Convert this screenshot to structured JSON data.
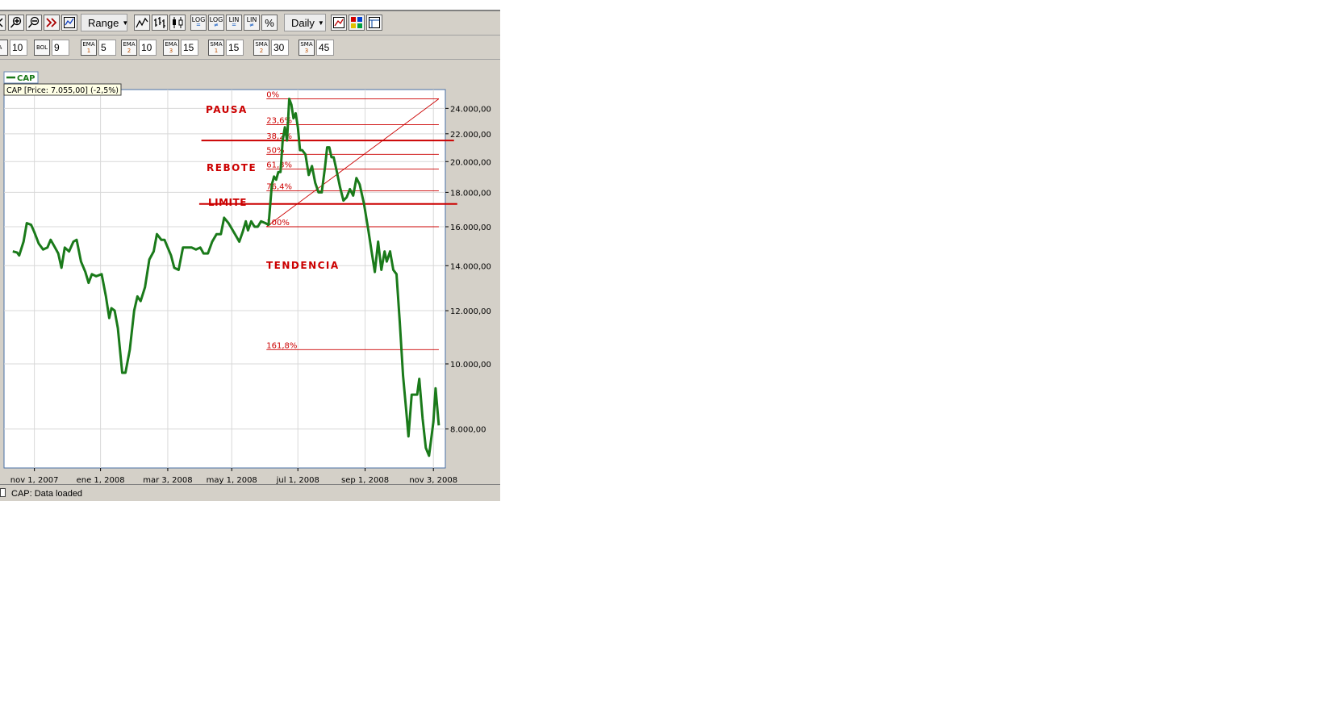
{
  "toolbar": {
    "range_label": "Range",
    "interval_label": "Daily",
    "scale_buttons": [
      {
        "top": "LOG",
        "bottom": "="
      },
      {
        "top": "LOG",
        "bottom": "≠"
      },
      {
        "top": "LIN",
        "bottom": "="
      },
      {
        "top": "LIN",
        "bottom": "≠"
      }
    ],
    "percent_label": "%"
  },
  "indicators": [
    {
      "name": "A",
      "sub": "",
      "value": "10"
    },
    {
      "name": "BOL",
      "sub": "",
      "value": "9"
    },
    {
      "name": "EMA",
      "sub": "1",
      "value": "5"
    },
    {
      "name": "EMA",
      "sub": "2",
      "value": "10"
    },
    {
      "name": "EMA",
      "sub": "3",
      "value": "15"
    },
    {
      "name": "SMA",
      "sub": "1",
      "value": "15"
    },
    {
      "name": "SMA",
      "sub": "2",
      "value": "30"
    },
    {
      "name": "SMA",
      "sub": "3",
      "value": "45"
    }
  ],
  "legend": {
    "symbol": "CAP",
    "info": "CAP [Price: 7.055,00] (-2,5%)"
  },
  "status": {
    "text": "CAP: Data loaded"
  },
  "annotations": {
    "pausa": "PAUSA",
    "rebote": "REBOTE",
    "limite": "LIMITE",
    "tendencia": "TENDENCIA"
  },
  "colors": {
    "series": "#1a7a1a",
    "annotation": "#cc0000"
  },
  "chart_data": {
    "type": "line",
    "title": "",
    "scale": "log",
    "grid": true,
    "legend_position": "top-left",
    "x_range": [
      "2007-10-04",
      "2008-11-14"
    ],
    "ylim": [
      7000,
      25600
    ],
    "x_ticks": [
      {
        "date": "2007-11-01",
        "label": "nov 1, 2007"
      },
      {
        "date": "2008-01-01",
        "label": "ene 1, 2008"
      },
      {
        "date": "2008-03-03",
        "label": "mar 3, 2008"
      },
      {
        "date": "2008-05-01",
        "label": "may 1, 2008"
      },
      {
        "date": "2008-07-01",
        "label": "jul 1, 2008"
      },
      {
        "date": "2008-09-01",
        "label": "sep 1, 2008"
      },
      {
        "date": "2008-11-03",
        "label": "nov 3, 2008"
      }
    ],
    "y_ticks": [
      {
        "value": 8000,
        "label": "8.000,00"
      },
      {
        "value": 10000,
        "label": "10.000,00"
      },
      {
        "value": 12000,
        "label": "12.000,00"
      },
      {
        "value": 14000,
        "label": "14.000,00"
      },
      {
        "value": 16000,
        "label": "16.000,00"
      },
      {
        "value": 18000,
        "label": "18.000,00"
      },
      {
        "value": 20000,
        "label": "20.000,00"
      },
      {
        "value": 22000,
        "label": "22.000,00"
      },
      {
        "value": 24000,
        "label": "24.000,00"
      }
    ],
    "series": [
      {
        "name": "CAP",
        "points": [
          [
            "2007-10-12",
            14700
          ],
          [
            "2007-10-16",
            14650
          ],
          [
            "2007-10-18",
            14500
          ],
          [
            "2007-10-22",
            15200
          ],
          [
            "2007-10-25",
            16200
          ],
          [
            "2007-10-29",
            16100
          ],
          [
            "2007-11-01",
            15700
          ],
          [
            "2007-11-05",
            15100
          ],
          [
            "2007-11-09",
            14800
          ],
          [
            "2007-11-13",
            14900
          ],
          [
            "2007-11-16",
            15300
          ],
          [
            "2007-11-20",
            14900
          ],
          [
            "2007-11-23",
            14600
          ],
          [
            "2007-11-26",
            13900
          ],
          [
            "2007-11-29",
            14900
          ],
          [
            "2007-12-03",
            14700
          ],
          [
            "2007-12-07",
            15200
          ],
          [
            "2007-12-10",
            15300
          ],
          [
            "2007-12-14",
            14200
          ],
          [
            "2007-12-18",
            13700
          ],
          [
            "2007-12-21",
            13200
          ],
          [
            "2007-12-24",
            13600
          ],
          [
            "2007-12-28",
            13500
          ],
          [
            "2008-01-02",
            13600
          ],
          [
            "2008-01-06",
            12600
          ],
          [
            "2008-01-09",
            11700
          ],
          [
            "2008-01-11",
            12100
          ],
          [
            "2008-01-14",
            12000
          ],
          [
            "2008-01-17",
            11300
          ],
          [
            "2008-01-21",
            9700
          ],
          [
            "2008-01-24",
            9700
          ],
          [
            "2008-01-28",
            10500
          ],
          [
            "2008-02-01",
            12000
          ],
          [
            "2008-02-04",
            12600
          ],
          [
            "2008-02-07",
            12400
          ],
          [
            "2008-02-11",
            13000
          ],
          [
            "2008-02-15",
            14300
          ],
          [
            "2008-02-19",
            14700
          ],
          [
            "2008-02-22",
            15600
          ],
          [
            "2008-02-26",
            15300
          ],
          [
            "2008-02-29",
            15300
          ],
          [
            "2008-03-03",
            14900
          ],
          [
            "2008-03-06",
            14500
          ],
          [
            "2008-03-09",
            13900
          ],
          [
            "2008-03-13",
            13800
          ],
          [
            "2008-03-17",
            14900
          ],
          [
            "2008-03-21",
            14900
          ],
          [
            "2008-03-25",
            14900
          ],
          [
            "2008-03-29",
            14800
          ],
          [
            "2008-04-02",
            14900
          ],
          [
            "2008-04-05",
            14600
          ],
          [
            "2008-04-09",
            14600
          ],
          [
            "2008-04-13",
            15200
          ],
          [
            "2008-04-17",
            15600
          ],
          [
            "2008-04-21",
            15600
          ],
          [
            "2008-04-24",
            16500
          ],
          [
            "2008-04-28",
            16200
          ],
          [
            "2008-05-01",
            15900
          ],
          [
            "2008-05-05",
            15500
          ],
          [
            "2008-05-08",
            15200
          ],
          [
            "2008-05-11",
            15700
          ],
          [
            "2008-05-14",
            16300
          ],
          [
            "2008-05-16",
            15800
          ],
          [
            "2008-05-19",
            16300
          ],
          [
            "2008-05-22",
            16000
          ],
          [
            "2008-05-25",
            16000
          ],
          [
            "2008-05-28",
            16300
          ],
          [
            "2008-06-01",
            16200
          ],
          [
            "2008-06-04",
            16100
          ],
          [
            "2008-06-07",
            18500
          ],
          [
            "2008-06-09",
            19000
          ],
          [
            "2008-06-11",
            18800
          ],
          [
            "2008-06-13",
            19300
          ],
          [
            "2008-06-15",
            19300
          ],
          [
            "2008-06-17",
            21500
          ],
          [
            "2008-06-19",
            22500
          ],
          [
            "2008-06-21",
            21500
          ],
          [
            "2008-06-23",
            24800
          ],
          [
            "2008-06-25",
            24300
          ],
          [
            "2008-06-27",
            23200
          ],
          [
            "2008-06-29",
            23600
          ],
          [
            "2008-07-01",
            22500
          ],
          [
            "2008-07-03",
            20800
          ],
          [
            "2008-07-05",
            20800
          ],
          [
            "2008-07-08",
            20500
          ],
          [
            "2008-07-11",
            19100
          ],
          [
            "2008-07-14",
            19700
          ],
          [
            "2008-07-17",
            18600
          ],
          [
            "2008-07-20",
            18000
          ],
          [
            "2008-07-23",
            18000
          ],
          [
            "2008-07-26",
            19600
          ],
          [
            "2008-07-28",
            21000
          ],
          [
            "2008-07-30",
            21000
          ],
          [
            "2008-08-01",
            20300
          ],
          [
            "2008-08-03",
            20300
          ],
          [
            "2008-08-06",
            19300
          ],
          [
            "2008-08-09",
            18300
          ],
          [
            "2008-08-12",
            17500
          ],
          [
            "2008-08-15",
            17700
          ],
          [
            "2008-08-18",
            18200
          ],
          [
            "2008-08-21",
            17800
          ],
          [
            "2008-08-24",
            18900
          ],
          [
            "2008-08-27",
            18500
          ],
          [
            "2008-08-31",
            17300
          ],
          [
            "2008-09-04",
            15800
          ],
          [
            "2008-09-07",
            14700
          ],
          [
            "2008-09-10",
            13700
          ],
          [
            "2008-09-13",
            15200
          ],
          [
            "2008-09-16",
            13800
          ],
          [
            "2008-09-19",
            14700
          ],
          [
            "2008-09-21",
            14200
          ],
          [
            "2008-09-24",
            14700
          ],
          [
            "2008-09-27",
            13800
          ],
          [
            "2008-09-30",
            13600
          ],
          [
            "2008-10-03",
            11500
          ],
          [
            "2008-10-06",
            9600
          ],
          [
            "2008-10-09",
            8500
          ],
          [
            "2008-10-11",
            7800
          ],
          [
            "2008-10-14",
            9000
          ],
          [
            "2008-10-17",
            9000
          ],
          [
            "2008-10-19",
            9000
          ],
          [
            "2008-10-21",
            9500
          ],
          [
            "2008-10-24",
            8300
          ],
          [
            "2008-10-27",
            7500
          ],
          [
            "2008-10-30",
            7300
          ],
          [
            "2008-11-03",
            8200
          ],
          [
            "2008-11-05",
            9200
          ],
          [
            "2008-11-08",
            8100
          ]
        ]
      }
    ],
    "fibonacci": {
      "start_date": "2008-06-02",
      "end_date": "2008-11-08",
      "from_value": 16000,
      "to_value": 24800,
      "levels": [
        {
          "label": "0%",
          "value": 24800
        },
        {
          "label": "23,6%",
          "value": 22700
        },
        {
          "label": "38,2%",
          "value": 21500
        },
        {
          "label": "50%",
          "value": 20500
        },
        {
          "label": "61,8%",
          "value": 19500
        },
        {
          "label": "76,4%",
          "value": 18100
        },
        {
          "label": "100%",
          "value": 16000
        },
        {
          "label": "161,8%",
          "value": 10500
        }
      ]
    },
    "horizontal_lines": [
      {
        "value": 21500,
        "start_date": "2008-04-03",
        "end_date": "2008-11-22"
      },
      {
        "value": 17300,
        "start_date": "2008-04-01",
        "end_date": "2008-11-25"
      }
    ]
  }
}
